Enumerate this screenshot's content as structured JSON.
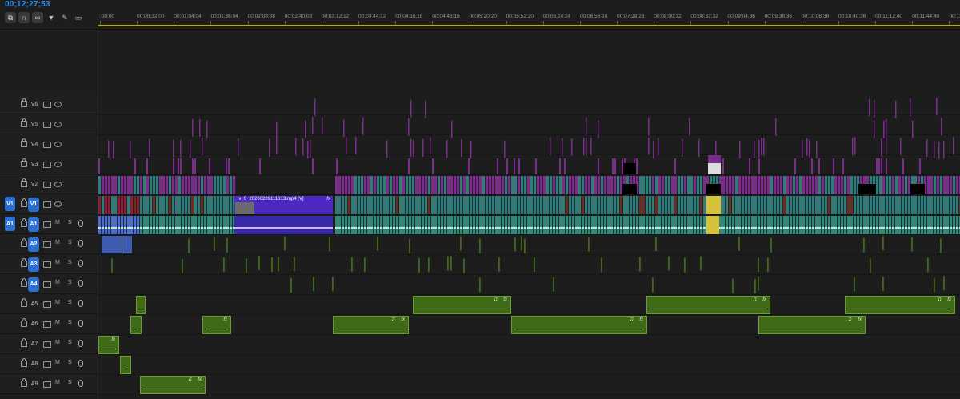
{
  "timecode": "00;12;27;53",
  "toolbar": {
    "icons": [
      "nest-sequence-icon",
      "snap-icon",
      "linked-selection-icon",
      "add-marker-icon",
      "wrench-icon",
      "captions-icon"
    ]
  },
  "ruler": {
    "labels": [
      ";00;00",
      "00;00;32;00",
      "00;01;04;04",
      "00;01;36;04",
      "00;02;08;08",
      "00;02;40;08",
      "00;03;12;12",
      "00;03;44;12",
      "00;04;16;16",
      "00;04;48;16",
      "00;05;20;20",
      "00;05;52;20",
      "00;06;24;24",
      "00;06;56;24",
      "00;07;28;28",
      "00;08;00;32",
      "00;08;32;32",
      "00;09;04;36",
      "00;09;36;36",
      "00;10;08;36",
      "00;10;40;36",
      "00;11;12;40",
      "00;11;44;40",
      "00;12;16;44"
    ]
  },
  "video_tracks": [
    {
      "name": "V6",
      "source": "",
      "targeted": false
    },
    {
      "name": "V5",
      "source": "",
      "targeted": false
    },
    {
      "name": "V4",
      "source": "",
      "targeted": false
    },
    {
      "name": "V3",
      "source": "",
      "targeted": false
    },
    {
      "name": "V2",
      "source": "",
      "targeted": false
    },
    {
      "name": "V1",
      "source": "V1",
      "targeted": true
    }
  ],
  "audio_tracks": [
    {
      "name": "A1",
      "source": "A1",
      "targeted": true,
      "mute": "M",
      "solo": "S"
    },
    {
      "name": "A2",
      "source": "",
      "targeted": true,
      "mute": "M",
      "solo": "S"
    },
    {
      "name": "A3",
      "source": "",
      "targeted": true,
      "mute": "M",
      "solo": "S"
    },
    {
      "name": "A4",
      "source": "",
      "targeted": true,
      "mute": "M",
      "solo": "S"
    },
    {
      "name": "A5",
      "source": "",
      "targeted": false,
      "mute": "M",
      "solo": "S"
    },
    {
      "name": "A6",
      "source": "",
      "targeted": false,
      "mute": "M",
      "solo": "S"
    },
    {
      "name": "A7",
      "source": "",
      "targeted": false,
      "mute": "M",
      "solo": "S"
    },
    {
      "name": "A8",
      "source": "",
      "targeted": false,
      "mute": "M",
      "solo": "S"
    },
    {
      "name": "A9",
      "source": "",
      "targeted": false,
      "mute": "M",
      "solo": "S"
    }
  ],
  "clips": {
    "v1_selected_name": "lv_0_20260209111613.mp4 [V]",
    "fx": "fx",
    "note": "♫"
  },
  "colors": {
    "accent": "#2a6fd1",
    "timecode": "#2e8df0",
    "video_clip": "#2f7d7a",
    "adjustment_clip": "#7a2d8a",
    "selected_video": "#4c2ac2",
    "audio_clip": "#2f8a7a",
    "music_clip": "#3f6b17",
    "marker_line": "#b8a92a"
  }
}
